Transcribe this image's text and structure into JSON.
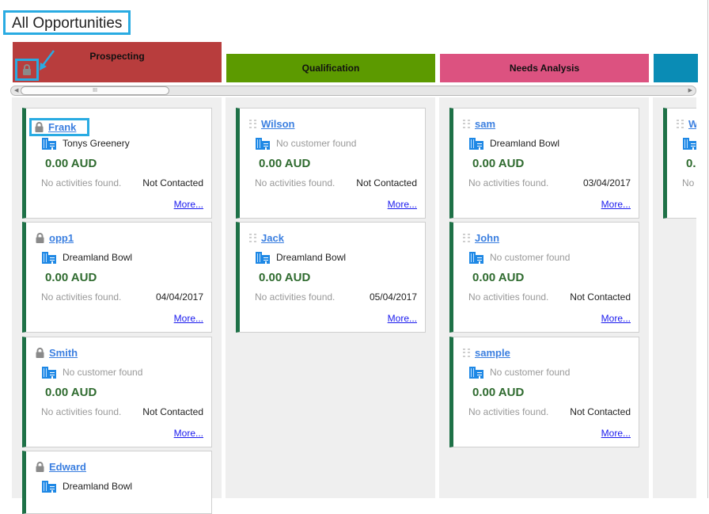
{
  "page": {
    "title": "All Opportunities"
  },
  "stages": [
    {
      "label": "Prospecting",
      "color": "#b83d3d",
      "cards": [
        {
          "name": "Frank",
          "customer": "Tonys Greenery",
          "customer_found": true,
          "amount": "0.00 AUD",
          "activities": "No activities found.",
          "status": "Not Contacted",
          "more": "More...",
          "locked": true
        },
        {
          "name": "opp1",
          "customer": "Dreamland Bowl",
          "customer_found": true,
          "amount": "0.00 AUD",
          "activities": "No activities found.",
          "status": "04/04/2017",
          "more": "More...",
          "locked": true
        },
        {
          "name": "Smith",
          "customer": "No customer found",
          "customer_found": false,
          "amount": "0.00 AUD",
          "activities": "No activities found.",
          "status": "Not Contacted",
          "more": "More...",
          "locked": true
        },
        {
          "name": "Edward",
          "customer": "Dreamland Bowl",
          "customer_found": true,
          "amount": "",
          "activities": "",
          "status": "",
          "more": "",
          "locked": true
        }
      ]
    },
    {
      "label": "Qualification",
      "color": "#5c9a00",
      "cards": [
        {
          "name": "Wilson",
          "customer": "No customer found",
          "customer_found": false,
          "amount": "0.00 AUD",
          "activities": "No activities found.",
          "status": "Not Contacted",
          "more": "More...",
          "locked": false
        },
        {
          "name": "Jack",
          "customer": "Dreamland Bowl",
          "customer_found": true,
          "amount": "0.00 AUD",
          "activities": "No activities found.",
          "status": "05/04/2017",
          "more": "More...",
          "locked": false
        }
      ]
    },
    {
      "label": "Needs Analysis",
      "color": "#dc5280",
      "cards": [
        {
          "name": "sam",
          "customer": "Dreamland Bowl",
          "customer_found": true,
          "amount": "0.00 AUD",
          "activities": "No activities found.",
          "status": "03/04/2017",
          "more": "More...",
          "locked": false
        },
        {
          "name": "John",
          "customer": "No customer found",
          "customer_found": false,
          "amount": "0.00 AUD",
          "activities": "No activities found.",
          "status": "Not Contacted",
          "more": "More...",
          "locked": false
        },
        {
          "name": "sample",
          "customer": "No customer found",
          "customer_found": false,
          "amount": "0.00 AUD",
          "activities": "No activities found.",
          "status": "Not Contacted",
          "more": "More...",
          "locked": false
        }
      ]
    },
    {
      "label": "",
      "color": "#0a8cb5",
      "cards": [
        {
          "name": "W",
          "customer": "",
          "customer_found": true,
          "amount": "0.",
          "activities": "No",
          "status": "",
          "more": "",
          "locked": false
        }
      ]
    }
  ],
  "scrollbar": {
    "grip": "III"
  },
  "icons": {
    "lock": "lock-icon",
    "building": "building-icon",
    "drag": "drag-handle-icon",
    "arrow": "annotation-arrow-icon"
  }
}
